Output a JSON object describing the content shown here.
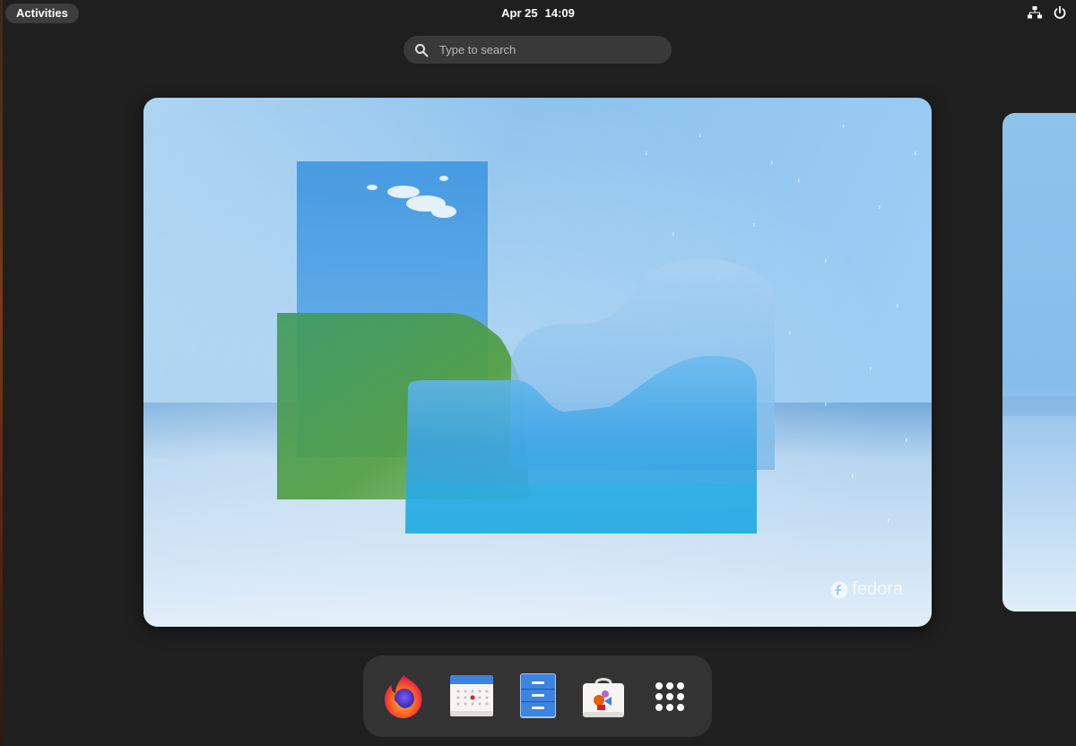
{
  "top_bar": {
    "activities_label": "Activities",
    "date": "Apr 25",
    "time": "14:09",
    "tray": [
      {
        "icon": "network-wired-icon"
      },
      {
        "icon": "power-icon"
      }
    ]
  },
  "search": {
    "placeholder": "Type to search"
  },
  "workspace": {
    "wallpaper_brand": "fedora"
  },
  "dash": {
    "apps": [
      {
        "name": "Firefox",
        "icon": "firefox-icon"
      },
      {
        "name": "Calendar",
        "icon": "calendar-icon"
      },
      {
        "name": "Files",
        "icon": "files-icon"
      },
      {
        "name": "Software",
        "icon": "software-store-icon"
      },
      {
        "name": "Show Applications",
        "icon": "app-grid-icon"
      }
    ]
  },
  "colors": {
    "panel_bg": "#1f1f1f",
    "pill_bg": "#3d3d3d",
    "search_bg": "#393939",
    "dash_bg": "#333333",
    "wallpaper_sky": "#8cc2ec"
  }
}
